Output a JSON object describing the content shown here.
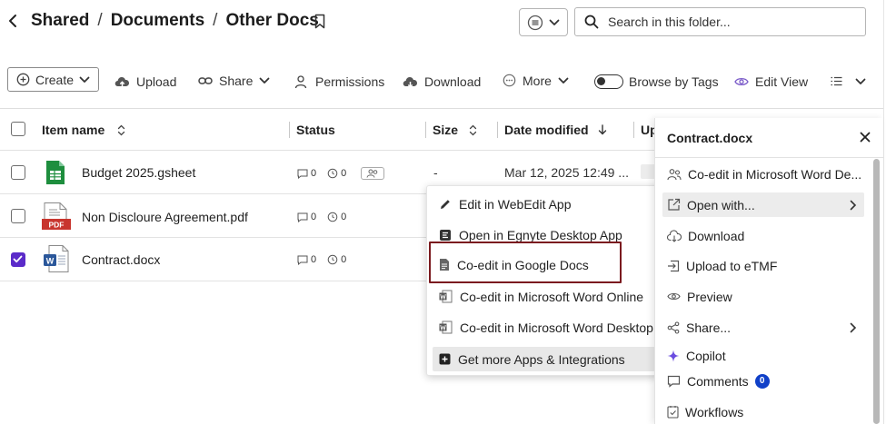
{
  "header": {
    "breadcrumb": [
      "Shared",
      "Documents",
      "Other Docs"
    ],
    "search_placeholder": "Search in this folder..."
  },
  "toolbar": {
    "create": "Create",
    "upload": "Upload",
    "share": "Share",
    "permissions": "Permissions",
    "download": "Download",
    "more": "More",
    "browse_by_tags": "Browse by Tags",
    "edit_view": "Edit View"
  },
  "table": {
    "columns": {
      "item_name": "Item name",
      "status": "Status",
      "size": "Size",
      "date_modified": "Date modified",
      "uploaded": "Up"
    },
    "rows": [
      {
        "name": "Budget 2025.gsheet",
        "comments": "0",
        "versions": "0",
        "size": "-",
        "date": "Mar 12, 2025 12:49 ...",
        "type": "gsheet",
        "checked": false
      },
      {
        "name": "Non Discloure Agreement.pdf",
        "comments": "0",
        "versions": "0",
        "size": "",
        "date": "",
        "type": "pdf",
        "pdf_label": "PDF",
        "checked": false
      },
      {
        "name": "Contract.docx",
        "comments": "0",
        "versions": "0",
        "size": "",
        "date": "",
        "type": "docx",
        "docx_label": "W",
        "checked": true
      }
    ]
  },
  "popup_menu": {
    "items": [
      {
        "label": "Edit in WebEdit App",
        "icon": "pencil-icon"
      },
      {
        "label": "Open in Egnyte Desktop App",
        "icon": "egnyte-desktop-icon"
      },
      {
        "label": "Co-edit in Google Docs",
        "icon": "google-docs-icon"
      },
      {
        "label": "Co-edit in Microsoft Word Online",
        "icon": "word-icon"
      },
      {
        "label": "Co-edit in Microsoft Word Desktop",
        "icon": "word-icon"
      },
      {
        "label": "Get more Apps & Integrations",
        "icon": "plus-square-icon"
      }
    ]
  },
  "side_panel": {
    "title": "Contract.docx",
    "items": [
      {
        "label": "Co-edit in Microsoft Word De...",
        "icon": "co-edit-icon"
      },
      {
        "label": "Open with...",
        "icon": "open-external-icon"
      },
      {
        "label": "Download",
        "icon": "download-cloud-icon"
      },
      {
        "label": "Upload to eTMF",
        "icon": "upload-etmf-icon"
      },
      {
        "label": "Preview",
        "icon": "eye-icon"
      },
      {
        "label": "Share...",
        "icon": "share-icon"
      },
      {
        "label": "Copilot",
        "icon": "copilot-sparkle-icon"
      },
      {
        "label": "Comments",
        "icon": "comment-icon",
        "badge": "0"
      },
      {
        "label": "Workflows",
        "icon": "workflow-icon"
      }
    ]
  },
  "colors": {
    "accent": "#5b2bc9",
    "badge": "#1040c8",
    "focus_outline": "#7b1a1f",
    "sheets_green": "#1e8e3e",
    "pdf_red": "#c8352e",
    "word_blue": "#2b579a"
  }
}
